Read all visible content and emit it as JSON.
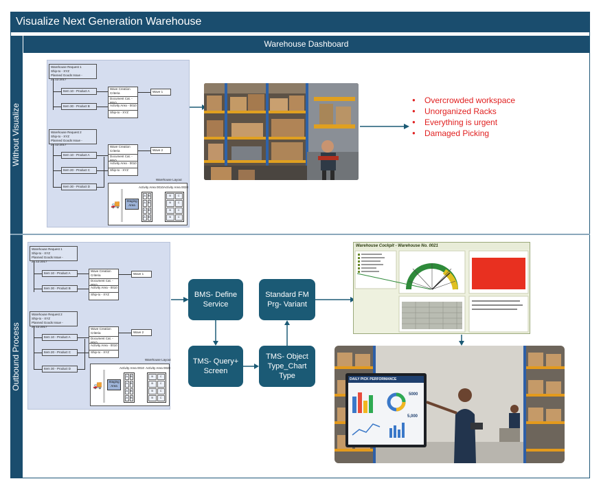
{
  "title": "Visualize Next Generation Warehouse",
  "dashboard_title": "Warehouse Dashboard",
  "sections": {
    "top_label": "Without Visualize",
    "bottom_label": "Outbound Process"
  },
  "issues": [
    "Overcrowded workspace",
    "Unorganized Racks",
    "Everything is urgent",
    "Damaged Picking"
  ],
  "wave_diagram": {
    "request1_lines": [
      "Warehouse Request 1",
      "Ship-to - XYZ",
      "Planned Goods Issue - 21.12.2017"
    ],
    "request2_lines": [
      "Warehouse Request 2",
      "Ship-to - XYZ",
      "Planned Goods Issue - 21.12.2017"
    ],
    "items_r1": [
      "Item 10 - Product A",
      "Item 30 - Product B"
    ],
    "items_r2": [
      "Item 10 - Product A",
      "Item 20 - Product C",
      "Item 30 - Product D"
    ],
    "criteria1": [
      "Wave Creation Criteria",
      "Document Cat. - PDO",
      "Activity Area - 0010",
      "Ship-to - XYZ"
    ],
    "criteria2": [
      "Wave Creation Criteria",
      "Document Cat. - PDO",
      "Activity Area - 0010",
      "Ship-to - XYZ"
    ],
    "wave1": "Wave 1",
    "wave2": "Wave 2",
    "layout_title": "Warehouse Layout",
    "area1": "Activity Area 0010",
    "area2": "Activity Area 0020",
    "staging": "Staging Area",
    "grid1": [
      "A",
      "B",
      "A",
      "B",
      "A",
      "B",
      "A",
      "B"
    ],
    "grid2": [
      "B",
      "C",
      "B",
      "C",
      "B",
      "C",
      "B",
      "C"
    ]
  },
  "process": {
    "bms": "BMS- Define Service",
    "standard_fm": "Standard FM Prg- Variant",
    "tms_query": "TMS- Query+ Screen",
    "tms_object": "TMS- Object Type_Chart Type"
  },
  "cockpit": {
    "title": "Warehouse Cockpit - Warehouse No. 0021"
  },
  "display": {
    "title": "DAILY PICK PERFORMANCE",
    "metric1": "5000",
    "metric2": "5,000"
  },
  "colors": {
    "navy": "#1a4d6e",
    "process_box": "#1b5a75",
    "alert": "#e02020",
    "diagram_bg": "#d5ddef"
  }
}
